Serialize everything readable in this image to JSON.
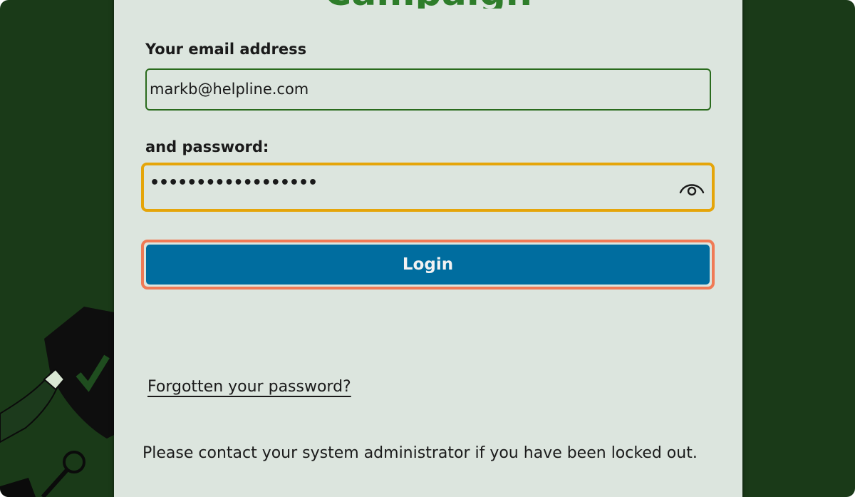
{
  "login_page": {
    "heading": "Campaign",
    "email_label": "Your email address",
    "email_value": "markb@helpline.com",
    "password_label": "and password:",
    "password_masked": "••••••••••••••••••",
    "show_password_icon": "eye-icon",
    "login_label": "Login",
    "forgot_link": "Forgotten your password?",
    "contact_note": "Please contact your system administrator if you have been locked out."
  },
  "colors": {
    "background": "#1a3a18",
    "panel": "#dce5de",
    "heading": "#2e7d2a",
    "email_border": "#2a6b1d",
    "password_focus_border": "#e5a50a",
    "login_button": "#006d9f",
    "login_focus_border": "#f07a55"
  }
}
